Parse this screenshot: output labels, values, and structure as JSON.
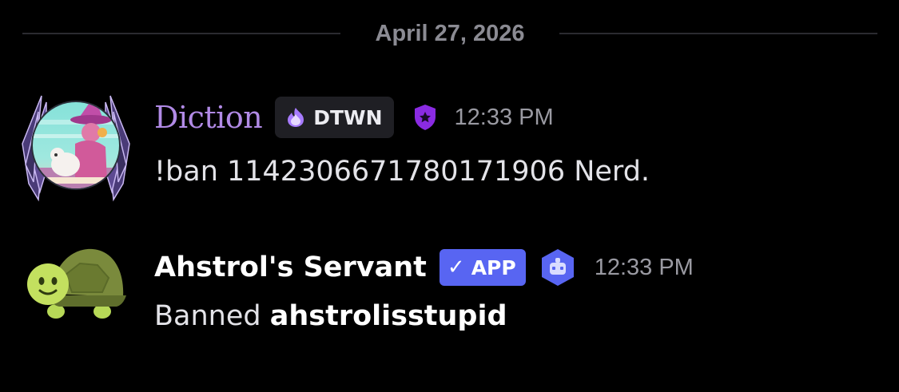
{
  "date_divider": {
    "label": "April 27, 2026"
  },
  "messages": [
    {
      "username": "Diction",
      "username_color": "#b18ae6",
      "guild_tag": {
        "icon": "purple-flame-icon",
        "label": "DTWN"
      },
      "role_icon": "purple-star-shield-icon",
      "timestamp": "12:33 PM",
      "content": "!ban 1142306671780171906 Nerd.",
      "avatar": "winged-witch-avatar"
    },
    {
      "username": "Ahstrol's Servant",
      "app_badge": {
        "icon": "checkmark-icon",
        "label": "APP"
      },
      "role_icon": "bot-hexagon-icon",
      "timestamp": "12:33 PM",
      "content_prefix": "Banned",
      "content_bold": "ahstrolisstupid",
      "avatar": "turtle-emoji-avatar"
    }
  ],
  "colors": {
    "background": "#000000",
    "divider_line": "#2b2b30",
    "timestamp": "#9a9aa2",
    "app_badge": "#5865f2",
    "role_shield": "#8a2be2"
  }
}
